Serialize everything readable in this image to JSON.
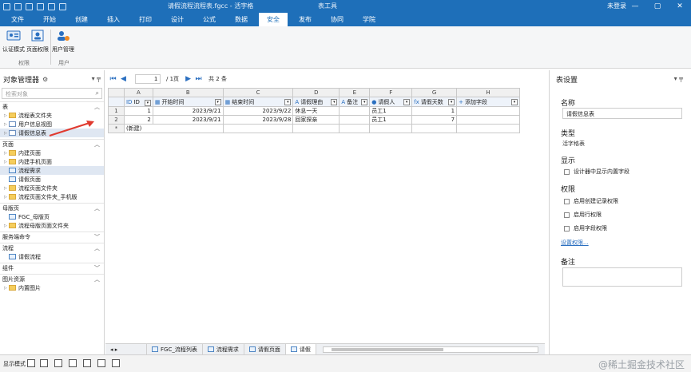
{
  "window": {
    "title": "请假流程流程表.fgcc - 活字格",
    "tool_title": "表工具",
    "login": "未登录",
    "controls": [
      "—",
      "▢",
      "✕"
    ]
  },
  "ribbon": {
    "tabs": [
      "文件",
      "开始",
      "创建",
      "插入",
      "打印",
      "设计",
      "公式",
      "数据",
      "安全",
      "发布",
      "协同",
      "学院"
    ],
    "active_tab": "安全",
    "buttons": {
      "auth_mode": "认证模式",
      "page_perm": "页面权限",
      "user_mgmt": "用户管理"
    },
    "groups": {
      "perm": "权限",
      "user": "用户"
    }
  },
  "left_panel": {
    "title": "对象管理器",
    "search_placeholder": "检索对象",
    "sections": {
      "tables": {
        "label": "表",
        "items": [
          "流程表文件夹",
          "用户信息视图",
          "请假信息表"
        ]
      },
      "pages": {
        "label": "页面",
        "items": [
          "内建页面",
          "内建手机页面",
          "流程需求",
          "请假页面",
          "流程页面文件夹",
          "流程页面文件夹_手机版"
        ]
      },
      "masters": {
        "label": "母版页",
        "items": [
          "FGC_母版页",
          "流程母版页面文件夹"
        ]
      },
      "commands": {
        "label": "服务端命令"
      },
      "process": {
        "label": "流程",
        "items": [
          "请假流程"
        ]
      },
      "components": {
        "label": "组件"
      },
      "images": {
        "label": "图片资源",
        "items": [
          "内置图片"
        ]
      }
    }
  },
  "main": {
    "nav": {
      "page_value": "1",
      "page_total": "/ 1页",
      "record_count": "共 2 条"
    },
    "grid": {
      "columns": [
        "A",
        "B",
        "C",
        "D",
        "E",
        "F",
        "G",
        "H"
      ],
      "fields": [
        "ID",
        "开始时间",
        "结束时间",
        "请假理由",
        "备注",
        "请假人",
        "请假天数",
        "添加字段"
      ],
      "field_types": [
        "ID",
        "📅",
        "📅",
        "A",
        "A",
        "👤",
        "fx",
        "+"
      ],
      "rows": [
        {
          "num": "1",
          "id": "1",
          "start": "2023/9/21",
          "end": "2023/9/22",
          "reason": "休息一天",
          "note": "",
          "person": "员工1",
          "days": "1"
        },
        {
          "num": "2",
          "id": "2",
          "start": "2023/9/21",
          "end": "2023/9/28",
          "reason": "回家探亲",
          "note": "",
          "person": "员工1",
          "days": "7"
        }
      ],
      "new_row": {
        "num": "*",
        "label": "(新建)"
      }
    },
    "bottom_tabs": [
      "FGC_流程列表",
      "流程需求",
      "请假页面",
      "请假"
    ]
  },
  "right_panel": {
    "title": "表设置",
    "name_label": "名称",
    "name_value": "请假信息表",
    "type_label": "类型",
    "type_value": "活字格表",
    "display_label": "显示",
    "display_option": "设计器中显示内置字段",
    "perm_label": "权限",
    "perm_options": [
      "启用创建记录权限",
      "启用行权限",
      "启用字段权限"
    ],
    "perm_link": "设置权限...",
    "notes_label": "备注"
  },
  "status": {
    "mode_label": "显示模式",
    "watermark": "@稀土掘金技术社区"
  },
  "colors": {
    "brand": "#1e6fb9",
    "accent_arrow": "#e03a2f"
  }
}
